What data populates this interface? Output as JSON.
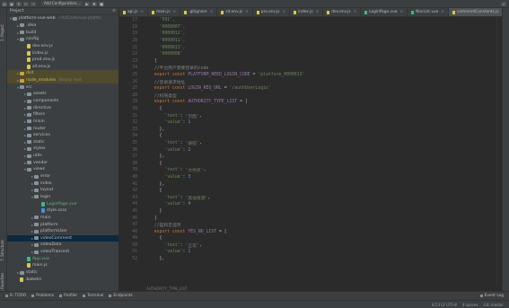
{
  "toolbar": {
    "run_config_label": "Add Configuration..."
  },
  "left_strip": {
    "project_label": "1: Project",
    "structure_label": "7: Structure",
    "favorites_label": "2: Favorites"
  },
  "project": {
    "header_label": "Project",
    "tree": [
      {
        "level": 0,
        "arrow": "▾",
        "icon": "folder",
        "label": "platform-vue-web",
        "sub": "~/UiCode/vue-platfor",
        "state": ""
      },
      {
        "level": 1,
        "arrow": "▸",
        "icon": "folder",
        "label": ".idea",
        "sub": "",
        "state": ""
      },
      {
        "level": 1,
        "arrow": "▸",
        "icon": "folder",
        "label": "build",
        "sub": "",
        "state": ""
      },
      {
        "level": 1,
        "arrow": "▾",
        "icon": "folder",
        "label": "config",
        "sub": "",
        "state": ""
      },
      {
        "level": 2,
        "arrow": "",
        "icon": "js",
        "label": "dev.env.js",
        "sub": "",
        "state": ""
      },
      {
        "level": 2,
        "arrow": "",
        "icon": "js",
        "label": "index.js",
        "sub": "",
        "state": ""
      },
      {
        "level": 2,
        "arrow": "",
        "icon": "js",
        "label": "prod.env.js",
        "sub": "",
        "state": ""
      },
      {
        "level": 2,
        "arrow": "",
        "icon": "js",
        "label": "sit.env.js",
        "sub": "",
        "state": ""
      },
      {
        "level": 1,
        "arrow": "▸",
        "icon": "folder-yellow",
        "label": "dist",
        "sub": "",
        "state": "hl"
      },
      {
        "level": 1,
        "arrow": "▸",
        "icon": "folder-yellow",
        "label": "node_modules",
        "sub": "library root",
        "state": "hl"
      },
      {
        "level": 1,
        "arrow": "▾",
        "icon": "folder",
        "label": "src",
        "sub": "",
        "state": ""
      },
      {
        "level": 2,
        "arrow": "▸",
        "icon": "folder",
        "label": "assets",
        "sub": "",
        "state": ""
      },
      {
        "level": 2,
        "arrow": "▸",
        "icon": "folder",
        "label": "components",
        "sub": "",
        "state": ""
      },
      {
        "level": 2,
        "arrow": "▸",
        "icon": "folder",
        "label": "directive",
        "sub": "",
        "state": ""
      },
      {
        "level": 2,
        "arrow": "▸",
        "icon": "folder",
        "label": "filters",
        "sub": "",
        "state": ""
      },
      {
        "level": 2,
        "arrow": "▸",
        "icon": "folder",
        "label": "mixin",
        "sub": "",
        "state": ""
      },
      {
        "level": 2,
        "arrow": "▸",
        "icon": "folder",
        "label": "router",
        "sub": "",
        "state": ""
      },
      {
        "level": 2,
        "arrow": "▸",
        "icon": "folder",
        "label": "services",
        "sub": "",
        "state": ""
      },
      {
        "level": 2,
        "arrow": "▸",
        "icon": "folder",
        "label": "static",
        "sub": "",
        "state": ""
      },
      {
        "level": 2,
        "arrow": "▸",
        "icon": "folder",
        "label": "styles",
        "sub": "",
        "state": ""
      },
      {
        "level": 2,
        "arrow": "▸",
        "icon": "folder",
        "label": "utils",
        "sub": "",
        "state": ""
      },
      {
        "level": 2,
        "arrow": "▸",
        "icon": "folder",
        "label": "vendor",
        "sub": "",
        "state": ""
      },
      {
        "level": 2,
        "arrow": "▾",
        "icon": "folder",
        "label": "views",
        "sub": "",
        "state": ""
      },
      {
        "level": 3,
        "arrow": "▸",
        "icon": "folder",
        "label": "error",
        "sub": "",
        "state": ""
      },
      {
        "level": 3,
        "arrow": "▸",
        "icon": "folder",
        "label": "index",
        "sub": "",
        "state": ""
      },
      {
        "level": 3,
        "arrow": "▸",
        "icon": "folder",
        "label": "layout",
        "sub": "",
        "state": ""
      },
      {
        "level": 3,
        "arrow": "▾",
        "icon": "folder",
        "label": "login",
        "sub": "",
        "state": ""
      },
      {
        "level": 4,
        "arrow": "",
        "icon": "vue",
        "label": "LoginPage.vue",
        "sub": "",
        "state": ""
      },
      {
        "level": 4,
        "arrow": "",
        "icon": "css",
        "label": "style.scss",
        "sub": "",
        "state": ""
      },
      {
        "level": 3,
        "arrow": "▸",
        "icon": "folder",
        "label": "main",
        "sub": "",
        "state": ""
      },
      {
        "level": 3,
        "arrow": "▸",
        "icon": "folder",
        "label": "platform",
        "sub": "",
        "state": ""
      },
      {
        "level": 3,
        "arrow": "▸",
        "icon": "folder",
        "label": "platformUser",
        "sub": "",
        "state": ""
      },
      {
        "level": 3,
        "arrow": "▸",
        "icon": "folder",
        "label": "videoComment",
        "sub": "",
        "state": "sel"
      },
      {
        "level": 3,
        "arrow": "▸",
        "icon": "folder",
        "label": "videoData",
        "sub": "",
        "state": ""
      },
      {
        "level": 3,
        "arrow": "▸",
        "icon": "folder",
        "label": "videoTransmit",
        "sub": "",
        "state": ""
      },
      {
        "level": 2,
        "arrow": "",
        "icon": "vue",
        "label": "App.vue",
        "sub": "",
        "state": ""
      },
      {
        "level": 2,
        "arrow": "",
        "icon": "js",
        "label": "main.js",
        "sub": "",
        "state": ""
      },
      {
        "level": 1,
        "arrow": "▸",
        "icon": "folder",
        "label": "static",
        "sub": "",
        "state": ""
      },
      {
        "level": 1,
        "arrow": "",
        "icon": "js",
        "label": ".babelrc",
        "sub": "",
        "state": ""
      }
    ]
  },
  "tabs": [
    {
      "label": "api.js",
      "type": "js",
      "active": false
    },
    {
      "label": "main.js",
      "type": "js",
      "active": false
    },
    {
      "label": ".gitignore",
      "type": "js",
      "active": false
    },
    {
      "label": "sit.env.js",
      "type": "js",
      "active": false
    },
    {
      "label": "pro.env.js",
      "type": "js",
      "active": false
    },
    {
      "label": "index.js",
      "type": "js",
      "active": false
    },
    {
      "label": "dev.env.js",
      "type": "js",
      "active": false
    },
    {
      "label": "LoginPage.vue",
      "type": "vue",
      "active": false
    },
    {
      "label": "NavList.vue",
      "type": "vue",
      "active": false
    },
    {
      "label": "commentConstants.js",
      "type": "js",
      "active": true
    }
  ],
  "code": [
    {
      "n": "17",
      "t": [
        [
          "str",
          "    '501',"
        ]
      ]
    },
    {
      "n": "18",
      "t": [
        [
          "str",
          "    '0000007',"
        ]
      ]
    },
    {
      "n": "19",
      "t": [
        [
          "str",
          "    '0000012',"
        ]
      ]
    },
    {
      "n": "20",
      "t": [
        [
          "str",
          "    '0000011',"
        ]
      ]
    },
    {
      "n": "21",
      "t": [
        [
          "str",
          "    '0000013',"
        ]
      ]
    },
    {
      "n": "22",
      "t": [
        [
          "str",
          "    '0000008'"
        ]
      ]
    },
    {
      "n": "23",
      "t": [
        [
          "key",
          "  ]"
        ]
      ]
    },
    {
      "n": "24",
      "t": [
        [
          "cmt",
          "  //平台用户需要登录的code"
        ]
      ]
    },
    {
      "n": "25",
      "t": [
        [
          "kw",
          "  export const "
        ],
        [
          "var",
          "PLATFORM_NEED_LOGIN_CODE"
        ],
        [
          "key",
          " = "
        ],
        [
          "str",
          "'platform_0000013'"
        ]
      ]
    },
    {
      "n": "26",
      "t": [
        [
          "cmt",
          "  //登录请求地址"
        ]
      ]
    },
    {
      "n": "27",
      "t": [
        [
          "kw",
          "  export const "
        ],
        [
          "var",
          "LOGIN_REQ_URL"
        ],
        [
          "key",
          " = "
        ],
        [
          "str",
          "'/authUserLogin'"
        ]
      ]
    },
    {
      "n": "28",
      "t": [
        [
          "cmt",
          "  //权限类型"
        ]
      ]
    },
    {
      "n": "29",
      "t": [
        [
          "kw",
          "  export const "
        ],
        [
          "var",
          "AUTHORITY_TYPE_LIST"
        ],
        [
          "key",
          " = ["
        ]
      ]
    },
    {
      "n": "30",
      "t": [
        [
          "key",
          "    {"
        ]
      ]
    },
    {
      "n": "31",
      "t": [
        [
          "str",
          "      'text'"
        ],
        [
          "key",
          ": "
        ],
        [
          "str",
          "'页面'"
        ],
        [
          "key",
          ","
        ]
      ]
    },
    {
      "n": "32",
      "t": [
        [
          "str",
          "      'value'"
        ],
        [
          "key",
          ": "
        ],
        [
          "num",
          "1"
        ]
      ]
    },
    {
      "n": "33",
      "t": [
        [
          "key",
          "    },"
        ]
      ]
    },
    {
      "n": "34",
      "t": [
        [
          "key",
          "    {"
        ]
      ]
    },
    {
      "n": "35",
      "t": [
        [
          "str",
          "      'text'"
        ],
        [
          "key",
          ": "
        ],
        [
          "str",
          "'按钮'"
        ],
        [
          "key",
          ","
        ]
      ]
    },
    {
      "n": "36",
      "t": [
        [
          "str",
          "      'value'"
        ],
        [
          "key",
          ": "
        ],
        [
          "num",
          "2"
        ]
      ]
    },
    {
      "n": "37",
      "t": [
        [
          "key",
          "    },"
        ]
      ]
    },
    {
      "n": "38",
      "t": [
        [
          "key",
          "    {"
        ]
      ]
    },
    {
      "n": "39",
      "t": [
        [
          "str",
          "      'text'"
        ],
        [
          "key",
          ": "
        ],
        [
          "str",
          "'文件夹'"
        ],
        [
          "key",
          ","
        ]
      ]
    },
    {
      "n": "40",
      "t": [
        [
          "str",
          "      'value'"
        ],
        [
          "key",
          ": "
        ],
        [
          "num",
          "3"
        ]
      ]
    },
    {
      "n": "41",
      "t": [
        [
          "key",
          "    },"
        ]
      ]
    },
    {
      "n": "42",
      "t": [
        [
          "key",
          "    {"
        ]
      ]
    },
    {
      "n": "43",
      "t": [
        [
          "str",
          "      'text'"
        ],
        [
          "key",
          ": "
        ],
        [
          "str",
          "'其他资源'"
        ],
        [
          "key",
          ","
        ]
      ]
    },
    {
      "n": "44",
      "t": [
        [
          "str",
          "      'value'"
        ],
        [
          "key",
          ": "
        ],
        [
          "num",
          "4"
        ]
      ]
    },
    {
      "n": "45",
      "t": [
        [
          "key",
          "    }"
        ]
      ]
    },
    {
      "n": "46",
      "t": [
        [
          "key",
          "  ]"
        ]
      ]
    },
    {
      "n": "47",
      "t": [
        [
          "cmt",
          "  //是和否选项"
        ]
      ]
    },
    {
      "n": "48",
      "t": [
        [
          "kw",
          "  export const "
        ],
        [
          "var",
          "YES_NO_LIST"
        ],
        [
          "key",
          " = ["
        ]
      ]
    },
    {
      "n": "49",
      "t": [
        [
          "key",
          "    {"
        ]
      ]
    },
    {
      "n": "50",
      "t": [
        [
          "str",
          "      'text'"
        ],
        [
          "key",
          ": "
        ],
        [
          "str",
          "'正常'"
        ],
        [
          "key",
          ","
        ]
      ]
    },
    {
      "n": "51",
      "t": [
        [
          "str",
          "      'value'"
        ],
        [
          "key",
          ": "
        ],
        [
          "num",
          "1"
        ]
      ]
    },
    {
      "n": "52",
      "t": [
        [
          "key",
          "    },"
        ]
      ]
    }
  ],
  "editor_footer": "AUTHORITY_TYPE_LIST",
  "bottom_bar": {
    "items": [
      "6: TODO",
      "Problems",
      "Profiler",
      "Terminal",
      "Endpoints"
    ],
    "event_log": "Event Log"
  },
  "status_bar": {
    "left": "",
    "right": [
      "8:53  LF  UTF-8",
      "4 spaces",
      "Git: master"
    ]
  }
}
